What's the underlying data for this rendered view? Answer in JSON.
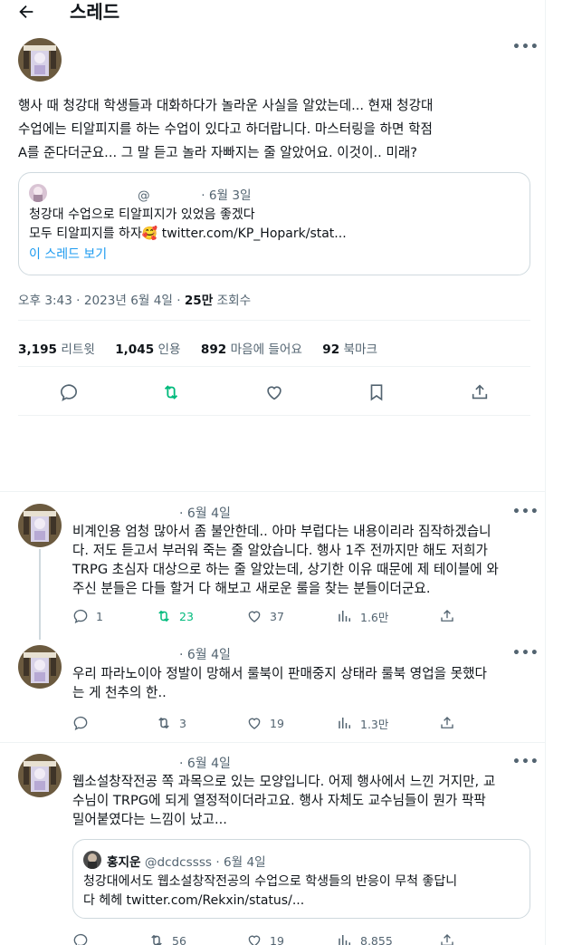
{
  "header": {
    "title": "스레드"
  },
  "main_tweet": {
    "text_lines": [
      "행사 때 청강대 학생들과 대화하다가 놀라운 사실을 알았는데... 현재 청강대",
      "수업에는 티알피지를 하는 수업이 있다고 하더랍니다. 마스터링을 하면 학점",
      "A를 준다더군요... 그 말 듣고 놀라 자빠지는 줄 알았어요. 이것이.. 미래?"
    ],
    "quote": {
      "handle": "@",
      "date": "· 6월 3일",
      "line1": "청강대 수업으로 티알피지가 있었음 좋겠다",
      "line2_prefix": "모두 티알피지를 하자",
      "emoji": "🥰",
      "link": "twitter.com/KP_Hopark/stat...",
      "show_thread": "이 스레드 보기"
    },
    "meta": {
      "time": "오후 3:43 · 2023년 6월 4일 · ",
      "views_count": "25만",
      "views_label": " 조회수"
    },
    "stats": [
      {
        "count": "3,195",
        "label": "리트윗"
      },
      {
        "count": "1,045",
        "label": "인용"
      },
      {
        "count": "892",
        "label": "마음에 들어요"
      },
      {
        "count": "92",
        "label": "북마크"
      }
    ]
  },
  "replies": [
    {
      "date": "· 6월 4일",
      "lines": [
        "비계인용 엄청 많아서 좀 불안한데.. 아마 부럽다는 내용이리라 짐작하겠습니",
        "다. 저도 듣고서 부러워 죽는 줄 알았습니다. 행사 1주 전까지만 해도 저희가",
        "TRPG 초심자 대상으로 하는 줄 알았는데, 상기한 이유 때문에 제 테이블에 와",
        "주신 분들은 다들 할거 다 해보고 새로운 룰을 찾는 분들이더군요."
      ],
      "reply_count": "1",
      "retweet_count": "23",
      "like_count": "37",
      "view_count": "1.6만"
    },
    {
      "date": "· 6월 4일",
      "lines": [
        "우리 파라노이아 정발이 망해서 룰북이 판매중지 상태라 룰북 영업을 못했다",
        "는 게 천추의 한.."
      ],
      "reply_count": "",
      "retweet_count": "3",
      "like_count": "19",
      "view_count": "1.3만"
    },
    {
      "date": "· 6월 4일",
      "lines": [
        "웹소설창작전공 쪽 과목으로 있는 모양입니다. 어제 행사에서 느낀 거지만, 교",
        "수님이 TRPG에 되게 열정적이더라고요. 행사 자체도 교수님들이 뭔가 팍팍",
        "밀어붙였다는 느낌이 났고..."
      ],
      "quote": {
        "name": "홍지운",
        "handle": "@dcdcssss",
        "date": "· 6월 4일",
        "line1": "청강대에서도 웹소설창작전공의 수업으로 학생들의 반응이 무척 좋답니",
        "line2": "다 헤헤 twitter.com/Rekxin/status/..."
      },
      "reply_count": "",
      "retweet_count": "56",
      "like_count": "19",
      "view_count": "8,855"
    }
  ],
  "colors": {
    "text": "#0f1419",
    "secondary": "#536471",
    "link": "#1d9bf0",
    "retweet_green": "#00ba7c",
    "border": "#eff3f4"
  },
  "icons": [
    "back-arrow-icon",
    "more-icon",
    "reply-icon",
    "retweet-icon",
    "like-icon",
    "bookmark-icon",
    "share-icon",
    "views-icon"
  ]
}
